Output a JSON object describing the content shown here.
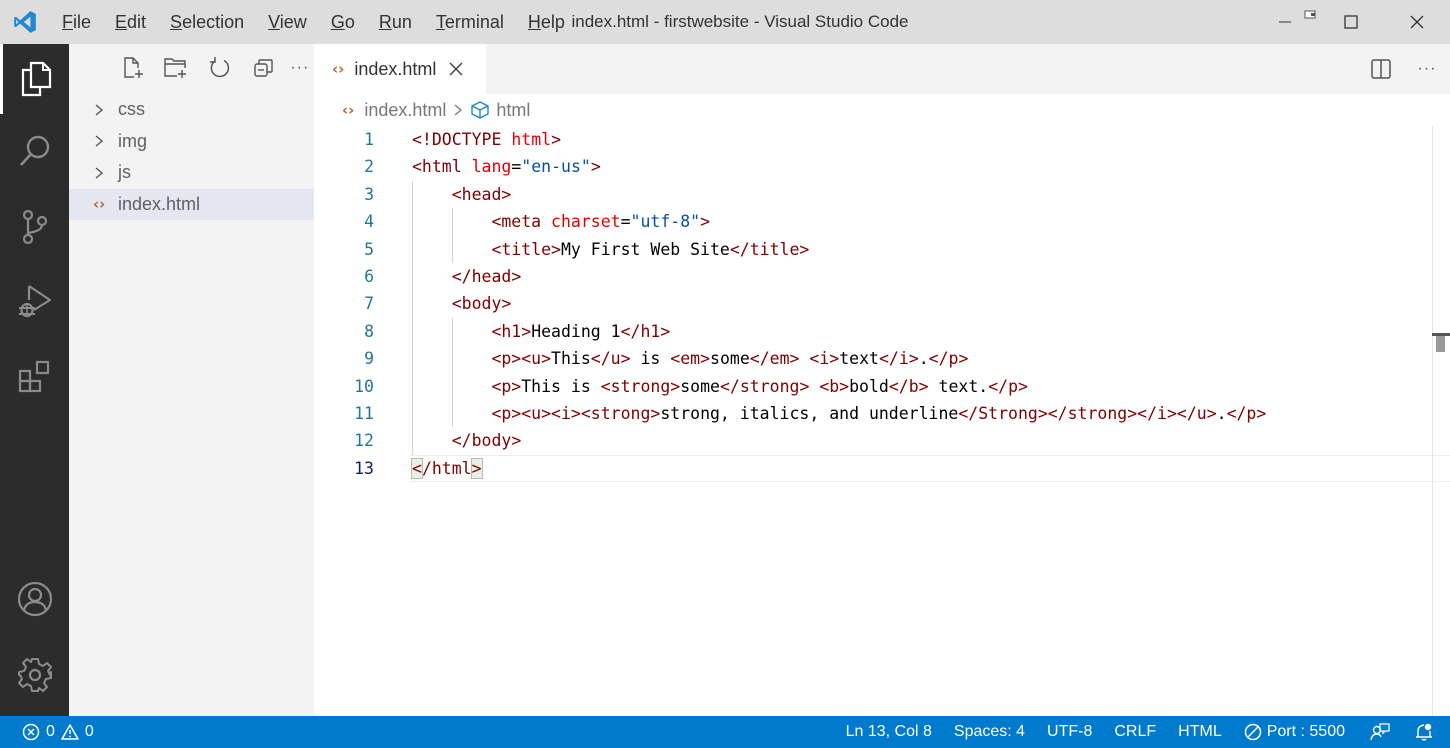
{
  "window": {
    "title": "index.html - firstwebsite - Visual Studio Code",
    "menu": [
      "File",
      "Edit",
      "Selection",
      "View",
      "Go",
      "Run",
      "Terminal",
      "Help"
    ],
    "mnemonics": [
      "F",
      "E",
      "S",
      "V",
      "G",
      "R",
      "T",
      "H"
    ]
  },
  "activity_bar": {
    "items": [
      {
        "name": "explorer",
        "icon": "files-icon",
        "active": true
      },
      {
        "name": "search",
        "icon": "search-icon"
      },
      {
        "name": "source-control",
        "icon": "source-control-icon"
      },
      {
        "name": "run-debug",
        "icon": "run-debug-icon"
      },
      {
        "name": "extensions",
        "icon": "extensions-icon"
      }
    ],
    "bottom_items": [
      {
        "name": "accounts",
        "icon": "account-icon"
      },
      {
        "name": "manage",
        "icon": "gear-icon"
      }
    ]
  },
  "sidebar": {
    "toolbar": [
      "new-file-icon",
      "new-folder-icon",
      "refresh-icon",
      "collapse-all-icon",
      "more-icon"
    ],
    "more_label": "···",
    "tree": [
      {
        "label": "css",
        "type": "folder"
      },
      {
        "label": "img",
        "type": "folder"
      },
      {
        "label": "js",
        "type": "folder"
      },
      {
        "label": "index.html",
        "type": "file",
        "selected": true
      }
    ]
  },
  "editor": {
    "tabs": [
      {
        "label": "index.html",
        "active": true
      }
    ],
    "more_label": "···",
    "breadcrumb": {
      "file": "index.html",
      "symbol": "html"
    },
    "lines": [
      {
        "n": "1",
        "indent": 0,
        "tokens": [
          [
            "t",
            "<!DOCTYPE "
          ],
          [
            "a",
            "html"
          ],
          [
            "t",
            ">"
          ]
        ]
      },
      {
        "n": "2",
        "indent": 0,
        "tokens": [
          [
            "t",
            "<html "
          ],
          [
            "a",
            "lang"
          ],
          [
            "p",
            "="
          ],
          [
            "s2",
            "\"en-us\""
          ],
          [
            "t",
            ">"
          ]
        ]
      },
      {
        "n": "3",
        "indent": 1,
        "tokens": [
          [
            "t",
            "<head>"
          ]
        ]
      },
      {
        "n": "4",
        "indent": 2,
        "tokens": [
          [
            "t",
            "<meta "
          ],
          [
            "a",
            "charset"
          ],
          [
            "p",
            "="
          ],
          [
            "s2",
            "\"utf-8\""
          ],
          [
            "t",
            ">"
          ]
        ]
      },
      {
        "n": "5",
        "indent": 2,
        "tokens": [
          [
            "t",
            "<title>"
          ],
          [
            "p",
            "My First Web Site"
          ],
          [
            "t",
            "</title>"
          ]
        ]
      },
      {
        "n": "6",
        "indent": 1,
        "tokens": [
          [
            "t",
            "</head>"
          ]
        ]
      },
      {
        "n": "7",
        "indent": 1,
        "tokens": [
          [
            "t",
            "<body>"
          ]
        ]
      },
      {
        "n": "8",
        "indent": 2,
        "tokens": [
          [
            "t",
            "<h1>"
          ],
          [
            "p",
            "Heading 1"
          ],
          [
            "t",
            "</h1>"
          ]
        ]
      },
      {
        "n": "9",
        "indent": 2,
        "tokens": [
          [
            "t",
            "<p><u>"
          ],
          [
            "p",
            "This"
          ],
          [
            "t",
            "</u>"
          ],
          [
            "p",
            " is "
          ],
          [
            "t",
            "<em>"
          ],
          [
            "p",
            "some"
          ],
          [
            "t",
            "</em>"
          ],
          [
            "p",
            " "
          ],
          [
            "t",
            "<i>"
          ],
          [
            "p",
            "text"
          ],
          [
            "t",
            "</i>"
          ],
          [
            "p",
            "."
          ],
          [
            "t",
            "</p>"
          ]
        ]
      },
      {
        "n": "10",
        "indent": 2,
        "tokens": [
          [
            "t",
            "<p>"
          ],
          [
            "p",
            "This is "
          ],
          [
            "t",
            "<strong>"
          ],
          [
            "p",
            "some"
          ],
          [
            "t",
            "</strong>"
          ],
          [
            "p",
            " "
          ],
          [
            "t",
            "<b>"
          ],
          [
            "p",
            "bold"
          ],
          [
            "t",
            "</b>"
          ],
          [
            "p",
            " text."
          ],
          [
            "t",
            "</p>"
          ]
        ]
      },
      {
        "n": "11",
        "indent": 2,
        "tokens": [
          [
            "t",
            "<p><u><i><strong>"
          ],
          [
            "p",
            "strong, italics, and underline"
          ],
          [
            "t",
            "</Strong></strong></i></u>"
          ],
          [
            "p",
            "."
          ],
          [
            "t",
            "</p>"
          ]
        ]
      },
      {
        "n": "12",
        "indent": 1,
        "tokens": [
          [
            "t",
            "</body>"
          ]
        ]
      },
      {
        "n": "13",
        "indent": 0,
        "current": true,
        "tokens": [
          [
            "m",
            "<"
          ],
          [
            "t",
            "/html"
          ],
          [
            "m",
            ">"
          ]
        ]
      }
    ]
  },
  "status_bar": {
    "errors": "0",
    "warnings": "0",
    "position": "Ln 13, Col 8",
    "spaces": "Spaces: 4",
    "encoding": "UTF-8",
    "eol": "CRLF",
    "language": "HTML",
    "port": "Port : 5500"
  },
  "colors": {
    "accent": "#007acc",
    "activity_bar": "#2c2c2c",
    "sidebar": "#f3f3f3",
    "tag": "#800000",
    "attribute": "#e50000",
    "string": "#0451a5",
    "line_number": "#237893"
  }
}
